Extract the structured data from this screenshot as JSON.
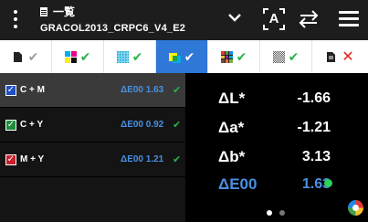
{
  "header": {
    "doc_label": "一覧",
    "title": "GRACOL2013_CRPC6_V4_E2"
  },
  "tabs": [
    {
      "icon": "document-icon",
      "status": "check",
      "active": false,
      "check_color": "#9e9e9e"
    },
    {
      "icon": "cmyk-patches-icon",
      "status": "check",
      "active": false
    },
    {
      "icon": "halftone-cyan-icon",
      "status": "check",
      "active": false
    },
    {
      "icon": "overprint-square-icon",
      "status": "check",
      "active": true
    },
    {
      "icon": "rgb-grid-icon",
      "status": "check",
      "active": false
    },
    {
      "icon": "checkerboard-icon",
      "status": "check",
      "active": false
    },
    {
      "icon": "document-icon",
      "status": "cross",
      "active": false
    }
  ],
  "rows": [
    {
      "label": "C + M",
      "value": "ΔE00 1.63",
      "checkbox_color": "#1e4fc4",
      "selected": true
    },
    {
      "label": "C + Y",
      "value": "ΔE00 0.92",
      "checkbox_color": "#1e8a3a",
      "selected": false
    },
    {
      "label": "M + Y",
      "value": "ΔE00 1.21",
      "checkbox_color": "#c8202e",
      "selected": false
    }
  ],
  "metrics": {
    "dl_label": "ΔL*",
    "dl_value": "-1.66",
    "da_label": "Δa*",
    "da_value": "-1.21",
    "db_label": "Δb*",
    "db_value": "3.13",
    "de_label": "ΔE00",
    "de_value": "1.63"
  },
  "pager": {
    "count": 2,
    "current": 1
  },
  "colors": {
    "accent": "#4a90e2",
    "ok": "#29b34a",
    "error": "#e2231a",
    "active_tab": "#2f78d8"
  }
}
